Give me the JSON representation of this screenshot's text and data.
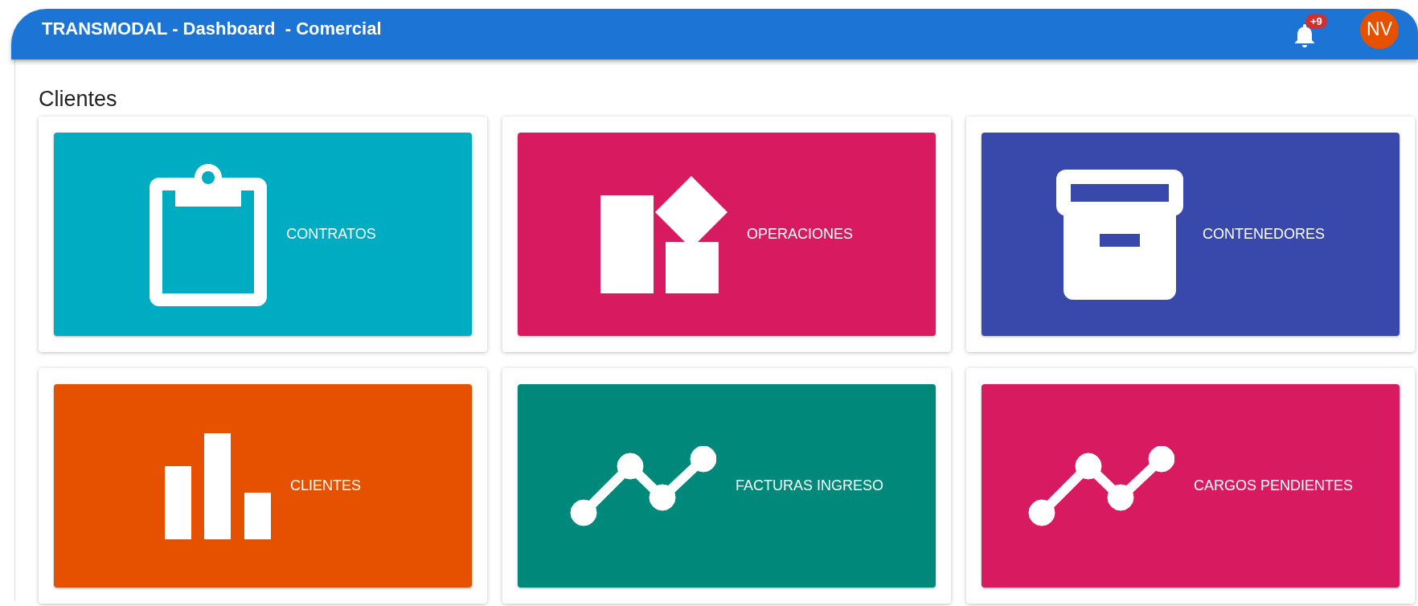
{
  "header": {
    "title": "TRANSMODAL - Dashboard  - Comercial",
    "notifications": "+9",
    "avatar": "NV"
  },
  "section": {
    "title": "Clientes"
  },
  "tiles": [
    {
      "label": "CONTRATOS",
      "kind": "clipboard",
      "color": "#00acc1"
    },
    {
      "label": "OPERACIONES",
      "kind": "shapes",
      "color": "#d81b60"
    },
    {
      "label": "CONTENEDORES",
      "kind": "archive",
      "color": "#3949ab"
    },
    {
      "label": "CLIENTES",
      "kind": "bars",
      "color": "#e65100"
    },
    {
      "label": "FACTURAS INGRESO",
      "kind": "line",
      "color": "#00897b"
    },
    {
      "label": "CARGOS PENDIENTES",
      "kind": "line",
      "color": "#d81b60"
    }
  ]
}
